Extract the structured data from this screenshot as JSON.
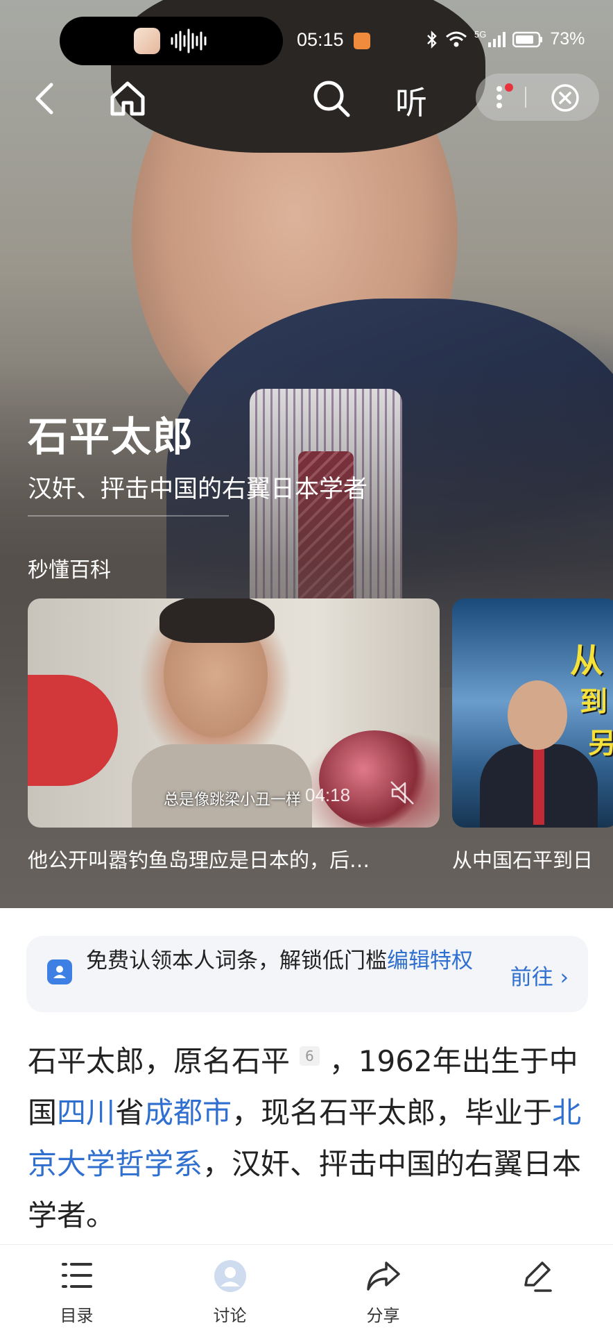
{
  "status_bar": {
    "time": "05:15",
    "battery": "73%",
    "network": "5G"
  },
  "nav": {
    "listen_label": "听"
  },
  "entry": {
    "title": "石平太郎",
    "subtitle": "汉奸、抨击中国的右翼日本学者"
  },
  "section": {
    "title": "秒懂百科"
  },
  "videos": [
    {
      "caption": "总是像跳梁小丑一样",
      "duration": "04:18",
      "title": "他公开叫嚣钓鱼岛理应是日本的，后…"
    },
    {
      "overlay_words": [
        "从",
        "到",
        "另"
      ],
      "title": "从中国石平到日"
    }
  ],
  "claim_banner": {
    "text": "免费认领本人词条，解锁低门槛",
    "link": "编辑特权",
    "action": "前往"
  },
  "intro": {
    "p1": "石平太郎，原名石平",
    "ref": "6",
    "p2": "，1962年出生于中国",
    "link1": "四川",
    "p3": "省",
    "link2": "成都市",
    "p4": "，现名石平太郎，毕业于",
    "link3": "北京大学哲学系",
    "p5": "，汉奸、抨击中国的右翼日本学者。"
  },
  "bottom_tabs": [
    {
      "label": "目录",
      "icon": "menu-icon"
    },
    {
      "label": "讨论",
      "icon": "avatar-icon"
    },
    {
      "label": "分享",
      "icon": "share-icon"
    },
    {
      "label": "",
      "icon": "edit-icon"
    }
  ],
  "colors": {
    "link": "#2f6fcf",
    "accent_red": "#e8323c",
    "hero_overlay": "#67625d"
  }
}
